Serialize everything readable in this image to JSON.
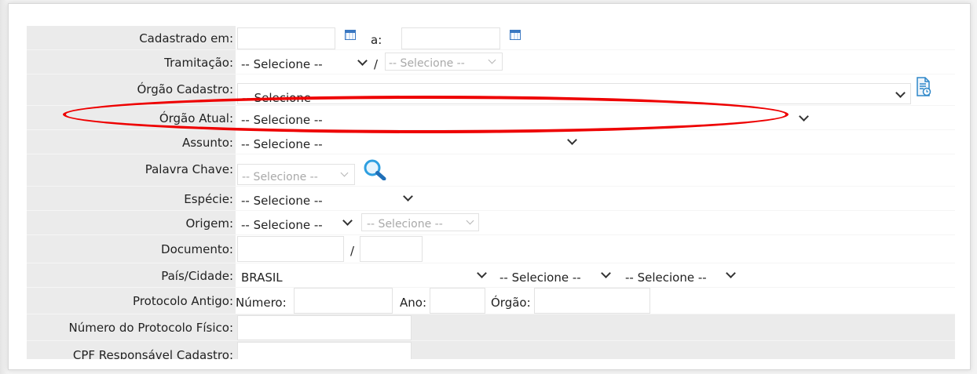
{
  "colors": {
    "label_bg": "#ebebeb",
    "highlight": "#ee0000",
    "icon_blue": "#2e87c9"
  },
  "icons": {
    "calendar": "calendar-icon",
    "document": "document-history-icon",
    "search": "search-icon"
  },
  "rows": {
    "cadastrado": {
      "label": "Cadastrado em:",
      "between": "a:"
    },
    "tramitacao": {
      "label": "Tramitação:",
      "select1": "-- Selecione --",
      "slash": "/",
      "select2": "-- Selecione --"
    },
    "orgao_cadastro": {
      "label": "Órgão Cadastro:",
      "select": "-- Selecione --"
    },
    "orgao_atual": {
      "label": "Órgão Atual:",
      "select": "-- Selecione --"
    },
    "assunto": {
      "label": "Assunto:",
      "select": "-- Selecione --"
    },
    "palavra_chave": {
      "label": "Palavra Chave:",
      "select": "-- Selecione --"
    },
    "especie": {
      "label": "Espécie:",
      "select": "-- Selecione --"
    },
    "origem": {
      "label": "Origem:",
      "select1": "-- Selecione --",
      "select2": "-- Selecione --"
    },
    "documento": {
      "label": "Documento:",
      "slash": "/"
    },
    "pais_cidade": {
      "label": "País/Cidade:",
      "select1": "BRASIL",
      "select2": "-- Selecione --",
      "select3": "-- Selecione --"
    },
    "protocolo_antigo": {
      "label": "Protocolo Antigo:",
      "numero": "Número:",
      "ano": "Ano:",
      "orgao": "Órgão:"
    },
    "numero_protocolo_fisico": {
      "label": "Número do Protocolo Físico:"
    },
    "cpf_responsavel": {
      "label": "CPF Responsável Cadastro:"
    }
  }
}
